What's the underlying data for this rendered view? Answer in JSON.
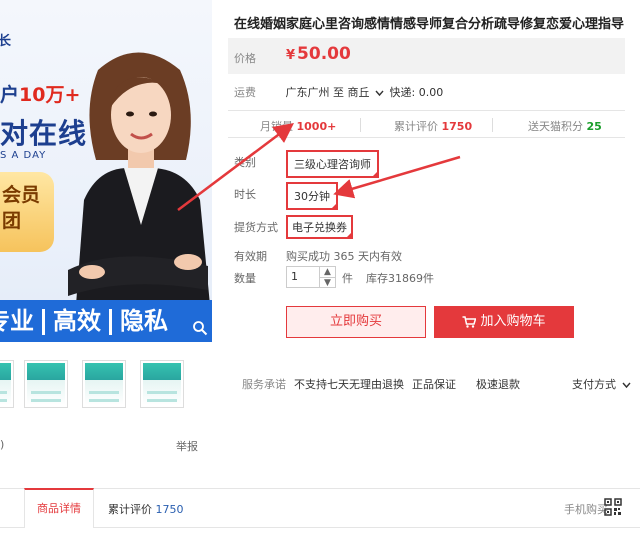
{
  "hero": {
    "corner": "长",
    "line1_prefix": "户",
    "line1_highlight": "10万+",
    "line2": "对在线",
    "line3": "S A DAY",
    "badge_line1": "会员",
    "badge_line2": "团",
    "bar_words": [
      "专业",
      "高效",
      "隐私"
    ]
  },
  "product": {
    "title": "在线婚姻家庭心里咨询感情情感导师复合分析疏导修复恋爱心理指导",
    "price_label": "价格",
    "currency": "¥",
    "price": "50.00",
    "shipping_label": "运费",
    "shipping_text": "广东广州 至 商丘",
    "shipping_fee": "快递: 0.00"
  },
  "stats": {
    "monthly_label": "月销量",
    "monthly_value": "1000+",
    "reviews_label": "累计评价",
    "reviews_value": "1750",
    "points_label": "送天猫积分",
    "points_value": "25"
  },
  "options": {
    "category_label": "类别",
    "category_value": "三级心理咨询师",
    "duration_label": "时长",
    "duration_value": "30分钟",
    "delivery_label": "提货方式",
    "delivery_value": "电子兑换券",
    "validity_label": "有效期",
    "validity_value": "购买成功 365 天内有效",
    "qty_label": "数量",
    "qty_value": "1",
    "qty_unit": "件",
    "stock": "库存31869件"
  },
  "actions": {
    "buy_now": "立即购买",
    "add_to_cart": "加入购物车"
  },
  "service": {
    "label": "服务承诺",
    "item1": "不支持七天无理由退换",
    "item2": "正品保证",
    "item3": "极速退款",
    "pay": "支付方式"
  },
  "left_misc": {
    "report": "举报",
    "paren": ")"
  },
  "tabs": {
    "detail": "商品详情",
    "reviews_label": "累计评价",
    "reviews_count": "1750",
    "mobile_buy": "手机购买"
  },
  "colors": {
    "accent": "#e4393c",
    "hero_blue": "#1f6bd8",
    "green": "#1a9e2b"
  }
}
